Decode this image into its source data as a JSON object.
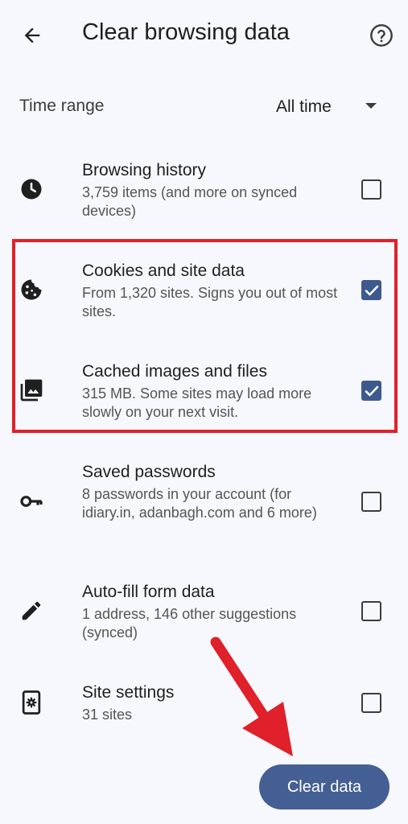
{
  "header": {
    "title": "Clear browsing data",
    "back_icon": "arrow-back-icon",
    "help_icon": "help-circle-icon"
  },
  "time_range": {
    "label": "Time range",
    "value": "All time"
  },
  "options": [
    {
      "icon": "clock-icon",
      "title": "Browsing history",
      "description": "3,759 items (and more on synced devices)",
      "checked": false
    },
    {
      "icon": "cookie-icon",
      "title": "Cookies and site data",
      "description": "From 1,320 sites. Signs you out of most sites.",
      "checked": true
    },
    {
      "icon": "image-library-icon",
      "title": "Cached images and files",
      "description": "315 MB. Some sites may load more slowly on your next visit.",
      "checked": true
    },
    {
      "icon": "key-icon",
      "title": "Saved passwords",
      "description": "8 passwords in your account (for idiary.in, adanbagh.com and 6 more)",
      "checked": false
    },
    {
      "icon": "pencil-icon",
      "title": "Auto-fill form data",
      "description": "1 address, 146 other suggestions (synced)",
      "checked": false
    },
    {
      "icon": "site-settings-icon",
      "title": "Site settings",
      "description": "31 sites",
      "checked": false
    }
  ],
  "clear_button": {
    "label": "Clear data"
  },
  "colors": {
    "background": "#f7f8fd",
    "accent": "#3d5a8f",
    "button": "#445f93",
    "annotation": "#e0202a"
  }
}
